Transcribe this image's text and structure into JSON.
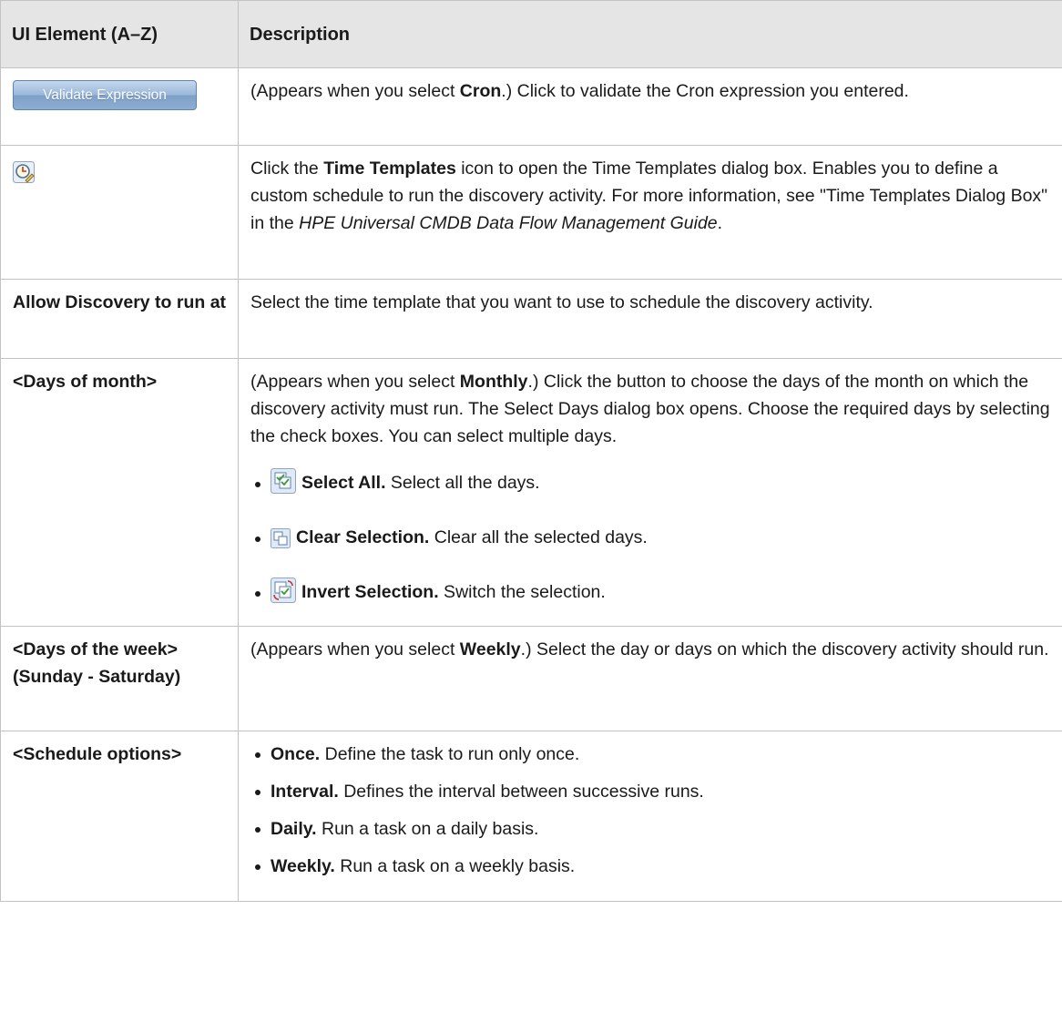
{
  "header": {
    "col_element": "UI Element (A–Z)",
    "col_description": "Description"
  },
  "rows": {
    "validate": {
      "button_label": "Validate Expression",
      "desc_pre": "(Appears when you select ",
      "desc_bold": "Cron",
      "desc_post": ".) Click to validate the Cron expression you entered."
    },
    "time_templates": {
      "icon": "clock-pencil-icon",
      "desc_pre": "Click the ",
      "desc_bold": "Time Templates",
      "desc_mid": " icon to open the Time Templates dialog box. Enables you to define a custom schedule to run the discovery activity. For more information, see \"Time Templates Dialog Box\" in the ",
      "desc_italic": "HPE Universal CMDB Data Flow Management Guide",
      "desc_end": "."
    },
    "allow": {
      "element": "Allow Discovery to run at",
      "desc": "Select the time template that you want to use to schedule the discovery activity."
    },
    "days_of_month": {
      "element": "<Days of month>",
      "desc_pre": "(Appears when you select ",
      "desc_bold": "Monthly",
      "desc_post": ".) Click the button to choose the days of the month on which the discovery activity must run. The Select Days dialog box opens. Choose the required days by selecting the check boxes. You can select multiple days.",
      "items": [
        {
          "icon": "select-all-icon",
          "bold": "Select All.",
          "text": " Select all the days."
        },
        {
          "icon": "clear-selection-icon",
          "bold": "Clear Selection.",
          "text": " Clear all the selected days."
        },
        {
          "icon": "invert-selection-icon",
          "bold": "Invert Selection.",
          "text": " Switch the selection."
        }
      ]
    },
    "days_of_week": {
      "element": "<Days of the week> (Sunday - Saturday)",
      "desc_pre": "(Appears when you select ",
      "desc_bold": "Weekly",
      "desc_post": ".) Select the day or days on which the discovery activity should run."
    },
    "schedule": {
      "element": "<Schedule options>",
      "items": [
        {
          "bold": "Once.",
          "text": " Define the task to run only once."
        },
        {
          "bold": "Interval.",
          "text": " Defines the interval between successive runs."
        },
        {
          "bold": "Daily.",
          "text": " Run a task on a daily basis."
        },
        {
          "bold": "Weekly.",
          "text": " Run a task on a weekly basis."
        }
      ]
    }
  }
}
